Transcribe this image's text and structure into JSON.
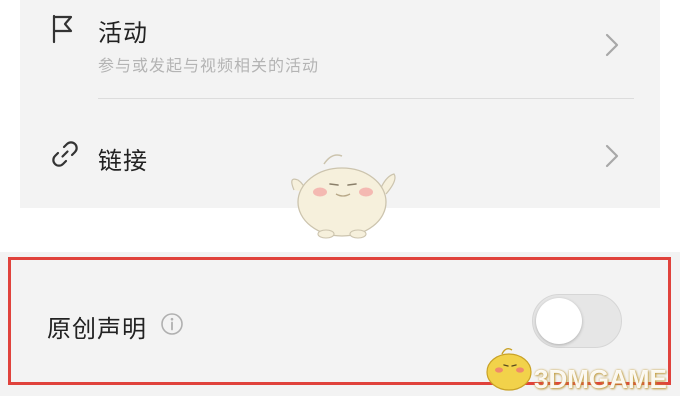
{
  "settings": {
    "activity": {
      "icon": "flag-icon",
      "title": "活动",
      "subtitle": "参与或发起与视频相关的活动",
      "chevron": "chevron-right-icon"
    },
    "link": {
      "icon": "link-icon",
      "title": "链接",
      "chevron": "chevron-right-icon"
    },
    "original_statement": {
      "label": "原创声明",
      "info_icon": "info-icon",
      "toggle_on": false
    }
  },
  "watermark": {
    "text": "3DMGAME"
  },
  "colors": {
    "highlight_border": "#e0423c",
    "card_background": "#f3f3f3",
    "subtitle_text": "#b4b4b4"
  }
}
